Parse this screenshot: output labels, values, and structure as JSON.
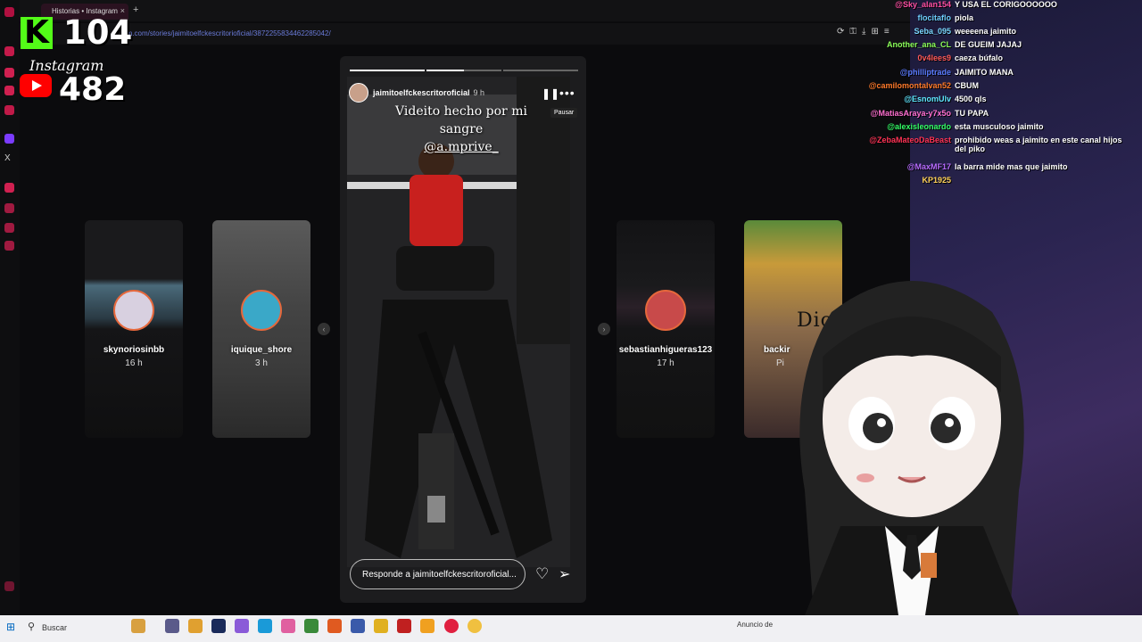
{
  "browser": {
    "tab_title": "Historias • Instagram",
    "tab_close": "×",
    "new_tab": "+",
    "url": "...m.com/stories/jaimitoelfckescritorioficial/3872255834462285042/"
  },
  "overlay": {
    "kick_logo": "K",
    "kick_count": "104",
    "instagram_label": "Instagram",
    "youtube_count": "482"
  },
  "stories": {
    "left_cards": [
      {
        "username": "skynoriosinbb",
        "time": "16 h"
      },
      {
        "username": "iquique_shore",
        "time": "3 h"
      }
    ],
    "right_cards": [
      {
        "username": "sebastianhigueras123",
        "time": "17 h"
      },
      {
        "username": "backir",
        "time": "Pi"
      }
    ],
    "prev_arrow": "‹",
    "next_arrow": "›"
  },
  "current_story": {
    "username": "jaimitoelfckescritoroficial",
    "time": "9 h",
    "caption_line1": "Videito hecho por mi sangre",
    "caption_line2": "@a.mprive_",
    "pause_tooltip": "Pausar",
    "reply_placeholder": "Responde a jaimitoelfckescritoroficial...",
    "progress_segments": 3,
    "progress_current": 1.5
  },
  "chat": [
    {
      "user": "@Sky_alan154",
      "msg": "Y USA EL CORIGOOOOOO",
      "color": "#ff4fa3"
    },
    {
      "user": "flocitaflo",
      "msg": "piola",
      "color": "#6fd0ff"
    },
    {
      "user": "Seba_095",
      "msg": "weeeena jaimito",
      "color": "#7ad6ff"
    },
    {
      "user": "Another_ana_CL",
      "msg": "DE GUEIM JAJAJ",
      "color": "#8cff5a"
    },
    {
      "user": "0v4lees9",
      "msg": "caeza búfalo",
      "color": "#ff5a5a"
    },
    {
      "user": "@philliptrade",
      "msg": "JAIMITO MANA",
      "color": "#5a7bff"
    },
    {
      "user": "@camilomontalvan52",
      "msg": "CBUM",
      "color": "#ff7a2a"
    },
    {
      "user": "@EsnomUlv",
      "msg": "4500 qls",
      "color": "#5fe8ff"
    },
    {
      "user": "@MatiasAraya-y7x5o",
      "msg": "TU PAPA",
      "color": "#ff6fd0"
    },
    {
      "user": "@alexisleonardo",
      "msg": "esta musculoso jaimito",
      "color": "#33ff66"
    },
    {
      "user": "@ZebaMateoDaBeast",
      "msg": "prohibido weas a jaimito en este canal hijos del piko",
      "color": "#ff3355"
    },
    {
      "user": "@MaxMF17",
      "msg": "la barra mide mas que jaimito",
      "color": "#b86bff"
    },
    {
      "user": "KP1925",
      "msg": "",
      "color": "#ffd25a"
    }
  ],
  "stream_text": "Dios Te Ama",
  "taskbar": {
    "search_placeholder": "Buscar",
    "ad_text": "Anuncio de"
  },
  "colors": {
    "kick_green": "#53fc18",
    "youtube_red": "#ff0000",
    "story_ring": "#e6683c",
    "taskbar": "#f0f0f3"
  }
}
